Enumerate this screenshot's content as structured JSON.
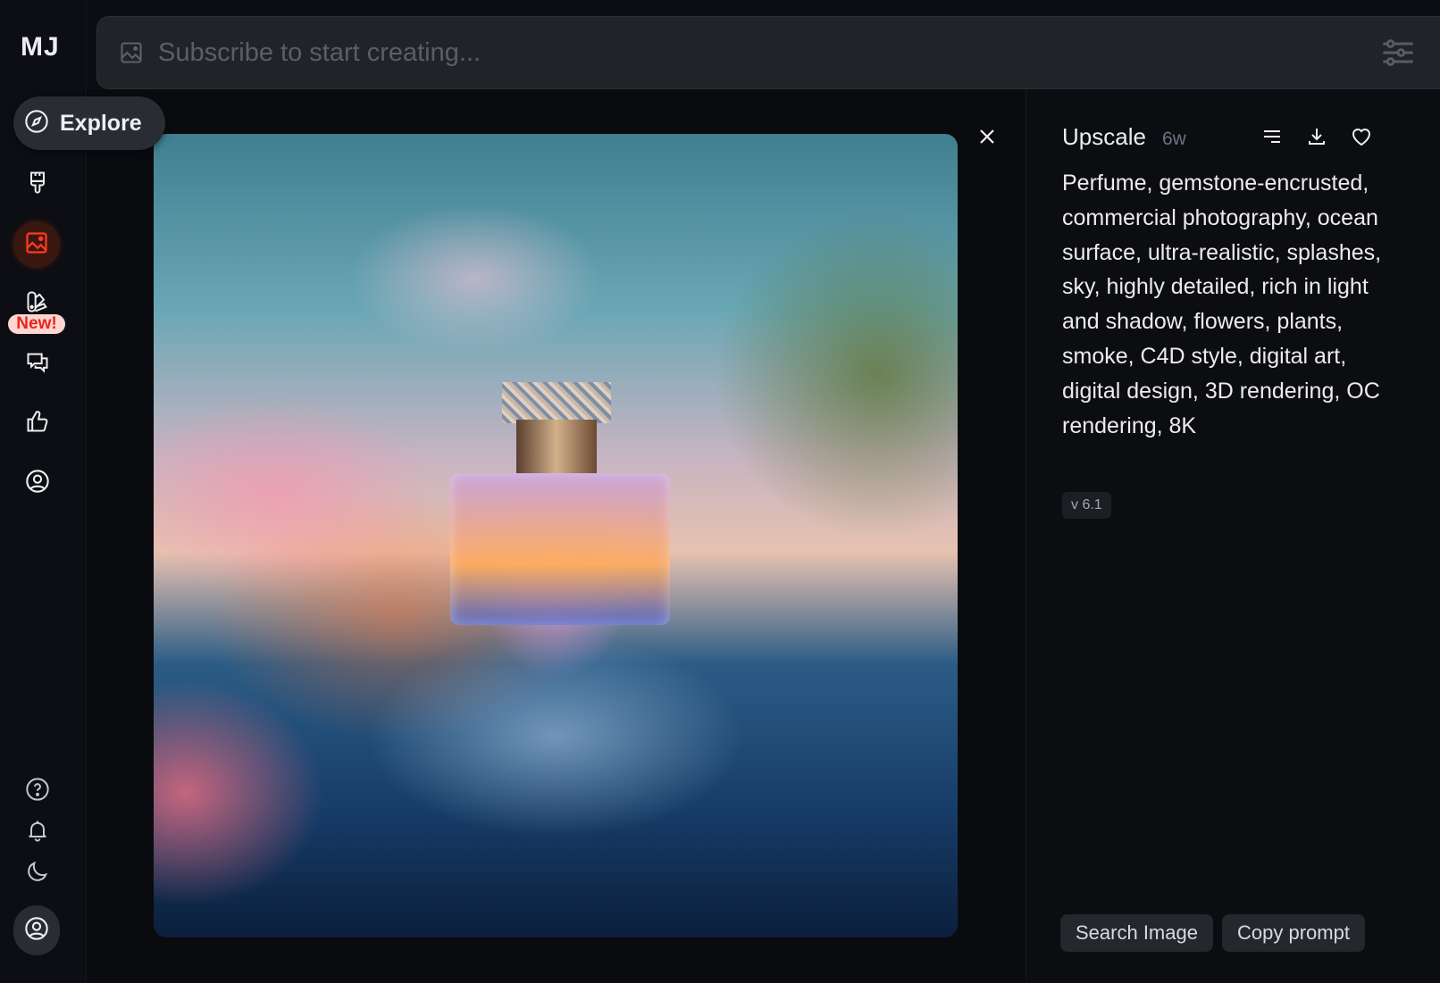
{
  "app": {
    "logo": "MJ"
  },
  "sidebar": {
    "explore_label": "Explore",
    "items": [
      {
        "name": "create",
        "icon": "brush-icon"
      },
      {
        "name": "organize",
        "icon": "image-icon",
        "active": true
      },
      {
        "name": "edit",
        "icon": "swatches-icon",
        "badge": "New!"
      },
      {
        "name": "chat",
        "icon": "chat-bubbles-icon"
      },
      {
        "name": "rate",
        "icon": "thumbs-up-icon"
      },
      {
        "name": "profile",
        "icon": "user-circle-icon"
      }
    ],
    "bottom_items": [
      {
        "name": "help",
        "icon": "question-circle-icon"
      },
      {
        "name": "notifications",
        "icon": "bell-icon"
      },
      {
        "name": "theme",
        "icon": "moon-icon"
      },
      {
        "name": "account",
        "icon": "user-circle-icon"
      }
    ],
    "accent_color": "#ff3b1f"
  },
  "prompt_bar": {
    "placeholder": "Subscribe to start creating...",
    "value": ""
  },
  "viewer": {
    "image_alt": "Perfume bottle with gemstone cap splashing in ocean surrounded by flowers"
  },
  "details": {
    "title": "Upscale",
    "age": "6w",
    "prompt": "Perfume, gemstone-encrusted, commercial photography, ocean surface, ultra-realistic, splashes, sky, highly detailed, rich in light and shadow, flowers, plants, smoke, C4D style, digital art, digital design, 3D rendering, OC rendering, 8K",
    "version": "v 6.1",
    "buttons": {
      "search_image": "Search Image",
      "copy_prompt": "Copy prompt"
    }
  }
}
